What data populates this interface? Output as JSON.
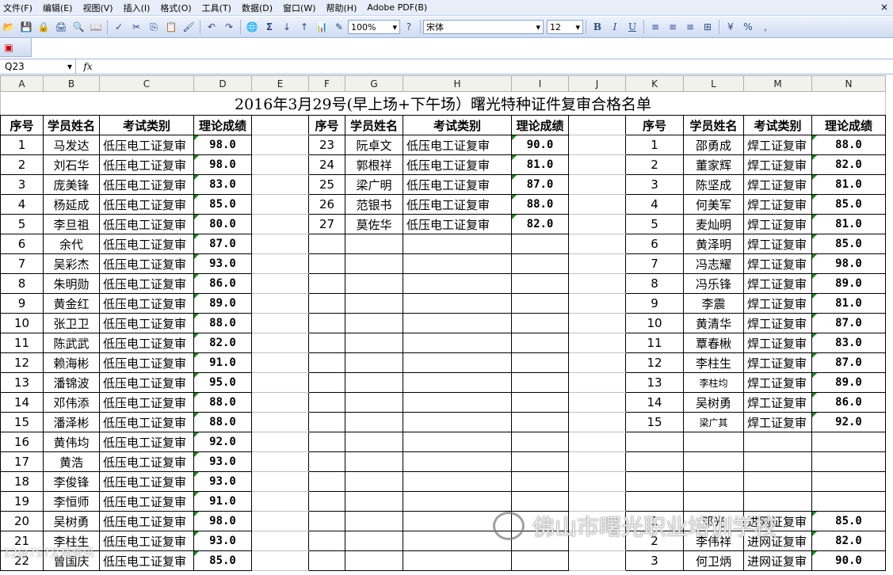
{
  "menu": [
    "文件(F)",
    "编辑(E)",
    "视图(V)",
    "插入(I)",
    "格式(O)",
    "工具(T)",
    "数据(D)",
    "窗口(W)",
    "帮助(H)",
    "Adobe PDF(B)"
  ],
  "close_glyph": "×",
  "toolbar": {
    "zoom": "100%",
    "font": "宋体",
    "font_size": "12",
    "bold": "B",
    "italic": "I",
    "underline": "U",
    "percent": "%"
  },
  "formula": {
    "cell_ref": "Q23",
    "fx": "fx",
    "content": ""
  },
  "columns": [
    "A",
    "B",
    "C",
    "D",
    "E",
    "F",
    "G",
    "H",
    "I",
    "J",
    "K",
    "L",
    "M",
    "N"
  ],
  "sheet": {
    "title": "2016年3月29号(早上场+下午场）曙光特种证件复审合格名单",
    "headers": {
      "num": "序号",
      "name": "学员姓名",
      "type": "考试类别",
      "score": "理论成绩"
    },
    "left": [
      [
        "1",
        "马发达",
        "低压电工证复审",
        "98.0"
      ],
      [
        "2",
        "刘石华",
        "低压电工证复审",
        "98.0"
      ],
      [
        "3",
        "庞美锋",
        "低压电工证复审",
        "83.0"
      ],
      [
        "4",
        "杨延成",
        "低压电工证复审",
        "85.0"
      ],
      [
        "5",
        "李旦祖",
        "低压电工证复审",
        "80.0"
      ],
      [
        "6",
        "余代",
        "低压电工证复审",
        "87.0"
      ],
      [
        "7",
        "吴彩杰",
        "低压电工证复审",
        "93.0"
      ],
      [
        "8",
        "朱明勋",
        "低压电工证复审",
        "86.0"
      ],
      [
        "9",
        "黄金红",
        "低压电工证复审",
        "89.0"
      ],
      [
        "10",
        "张卫卫",
        "低压电工证复审",
        "88.0"
      ],
      [
        "11",
        "陈武武",
        "低压电工证复审",
        "82.0"
      ],
      [
        "12",
        "赖海彬",
        "低压电工证复审",
        "91.0"
      ],
      [
        "13",
        "潘锦波",
        "低压电工证复审",
        "95.0"
      ],
      [
        "14",
        "邓伟添",
        "低压电工证复审",
        "88.0"
      ],
      [
        "15",
        "潘泽彬",
        "低压电工证复审",
        "88.0"
      ],
      [
        "16",
        "黄伟均",
        "低压电工证复审",
        "92.0"
      ],
      [
        "17",
        "黄浩",
        "低压电工证复审",
        "93.0"
      ],
      [
        "18",
        "李俊锋",
        "低压电工证复审",
        "93.0"
      ],
      [
        "19",
        "李恒师",
        "低压电工证复审",
        "91.0"
      ],
      [
        "20",
        "吴树勇",
        "低压电工证复审",
        "98.0"
      ],
      [
        "21",
        "李柱生",
        "低压电工证复审",
        "93.0"
      ],
      [
        "22",
        "曾国庆",
        "低压电工证复审",
        "85.0"
      ]
    ],
    "middle": [
      [
        "23",
        "阮卓文",
        "低压电工证复审",
        "90.0"
      ],
      [
        "24",
        "郭根祥",
        "低压电工证复审",
        "81.0"
      ],
      [
        "25",
        "梁广明",
        "低压电工证复审",
        "87.0"
      ],
      [
        "26",
        "范银书",
        "低压电工证复审",
        "88.0"
      ],
      [
        "27",
        "莫佐华",
        "低压电工证复审",
        "82.0"
      ]
    ],
    "right": [
      [
        "1",
        "邵勇成",
        "焊工证复审",
        "88.0"
      ],
      [
        "2",
        "董家辉",
        "焊工证复审",
        "82.0"
      ],
      [
        "3",
        "陈坚成",
        "焊工证复审",
        "81.0"
      ],
      [
        "4",
        "何美军",
        "焊工证复审",
        "85.0"
      ],
      [
        "5",
        "麦灿明",
        "焊工证复审",
        "81.0"
      ],
      [
        "6",
        "黄泽明",
        "焊工证复审",
        "85.0"
      ],
      [
        "7",
        "冯志耀",
        "焊工证复审",
        "98.0"
      ],
      [
        "8",
        "冯乐锋",
        "焊工证复审",
        "89.0"
      ],
      [
        "9",
        "李震",
        "焊工证复审",
        "81.0"
      ],
      [
        "10",
        "黄清华",
        "焊工证复审",
        "87.0"
      ],
      [
        "11",
        "覃春楸",
        "焊工证复审",
        "83.0"
      ],
      [
        "12",
        "李柱生",
        "焊工证复审",
        "87.0"
      ],
      [
        "13",
        "李柱均",
        "焊工证复审",
        "89.0"
      ],
      [
        "14",
        "吴树勇",
        "焊工证复审",
        "86.0"
      ],
      [
        "15",
        "梁广其",
        "焊工证复审",
        "92.0"
      ]
    ],
    "right_bottom": [
      [
        "1",
        "邓光",
        "进网证复审",
        "85.0"
      ],
      [
        "2",
        "李伟祥",
        "进网证复审",
        "82.0"
      ],
      [
        "3",
        "何卫炳",
        "进网证复审",
        "90.0"
      ]
    ]
  },
  "watermark": {
    "text": "佛山市曙光职业培训学校",
    "corner": "12@757文档资讯"
  }
}
